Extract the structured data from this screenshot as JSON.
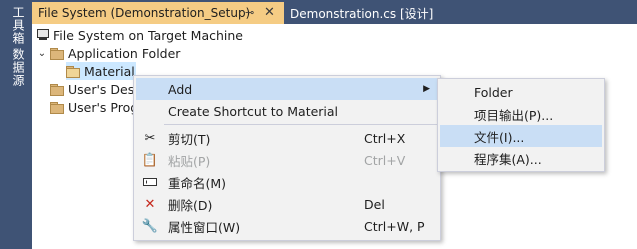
{
  "side_tabs": [
    "工具箱",
    "数据源"
  ],
  "tabs": {
    "active": {
      "label": "File System (Demonstration_Setup)",
      "pin": "⊸",
      "close": "✕"
    },
    "inactive": {
      "label": "Demonstration.cs [设计]"
    }
  },
  "tree": {
    "root": "File System on Target Machine",
    "app_folder": "Application Folder",
    "material": "Material",
    "users_desktop": "User's Desk",
    "users_programs": "User's Prog"
  },
  "context_menu": {
    "add": "Add",
    "create_shortcut": "Create Shortcut to Material",
    "cut": {
      "label": "剪切(T)",
      "shortcut": "Ctrl+X"
    },
    "paste": {
      "label": "粘贴(P)",
      "shortcut": "Ctrl+V"
    },
    "rename": {
      "label": "重命名(M)"
    },
    "delete": {
      "label": "删除(D)",
      "shortcut": "Del"
    },
    "properties": {
      "label": "属性窗口(W)",
      "shortcut": "Ctrl+W, P"
    }
  },
  "add_submenu": {
    "folder": "Folder",
    "project_output": "项目输出(P)...",
    "file": "文件(I)...",
    "assembly": "程序集(A)..."
  }
}
